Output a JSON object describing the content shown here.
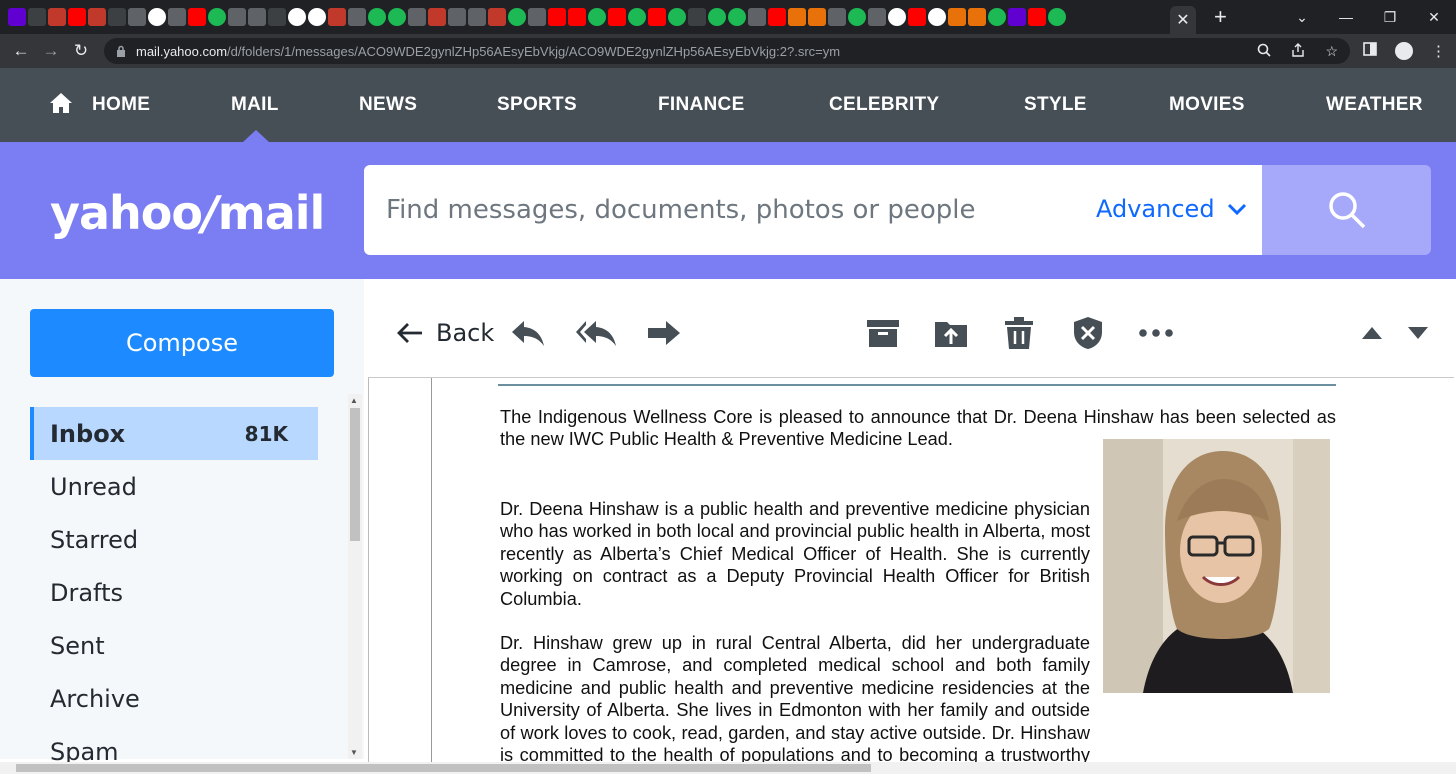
{
  "browser": {
    "url_host": "mail.yahoo.com",
    "url_path": "/d/folders/1/messages/ACO9WDE2gynlZHp56AEsyEbVkjg/ACO9WDE2gynlZHp56AEsyEbVkjg:2?.src=ym",
    "new_tab": "+",
    "close_tab": "✕"
  },
  "nav": {
    "items": [
      "HOME",
      "MAIL",
      "NEWS",
      "SPORTS",
      "FINANCE",
      "CELEBRITY",
      "STYLE",
      "MOVIES",
      "WEATHER"
    ],
    "active": "MAIL"
  },
  "header": {
    "logo_left": "yahoo",
    "logo_slash": "/",
    "logo_right": "mail",
    "search_placeholder": "Find messages, documents, photos or people",
    "advanced_label": "Advanced"
  },
  "sidebar": {
    "compose_label": "Compose",
    "folders": [
      {
        "label": "Inbox",
        "count": "81K"
      },
      {
        "label": "Unread"
      },
      {
        "label": "Starred"
      },
      {
        "label": "Drafts"
      },
      {
        "label": "Sent"
      },
      {
        "label": "Archive"
      },
      {
        "label": "Spam"
      }
    ]
  },
  "toolbar": {
    "back_label": "Back"
  },
  "message": {
    "paragraphs": [
      "The Indigenous Wellness Core is pleased to announce that Dr. Deena Hinshaw has been selected as the new IWC Public Health & Preventive Medicine Lead.",
      "Dr. Deena Hinshaw is a public health and preventive medicine physician who has worked in both local and provincial public health in Alberta, most recently as Alberta’s Chief Medical Officer of Health. She is currently working on contract as a Deputy Provincial Health Officer for British Columbia.",
      "Dr. Hinshaw grew up in rural Central Alberta, did her undergraduate degree in Camrose, and completed medical school and both family medicine and public health and preventive medicine residencies at the University of Alberta. She lives in Edmonton with her family and outside of work loves to cook, read, garden, and stay active outside. Dr. Hinshaw is committed to the health of populations and to becoming a trustworthy ally of Indigenous peoples in implementing the"
    ]
  },
  "colors": {
    "nav_bg": "#464e56",
    "header_bg": "#7b7df2",
    "compose_bg": "#1d8bff",
    "selected_folder_bg": "#b8d8ff",
    "advanced_link": "#0f69ff"
  }
}
